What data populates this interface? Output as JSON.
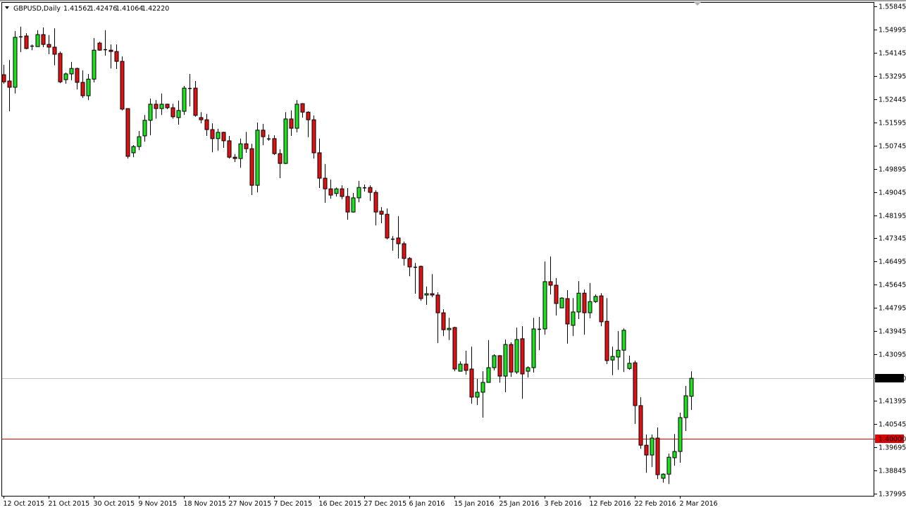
{
  "header": {
    "symbol": "GBPUSD,Daily",
    "open": "1.41562",
    "high": "1.42476",
    "low": "1.41064",
    "close": "1.42220"
  },
  "colors": {
    "bull": "#1ee01e",
    "bear": "#e01010",
    "wick": "#000000",
    "price_line": "#c0c0c0",
    "level_line": "#e00000"
  },
  "chart_data": {
    "type": "candlestick",
    "title": "GBPUSD,Daily",
    "xlabel": "",
    "ylabel": "",
    "ylim": [
      1.37995,
      1.55845
    ],
    "grid": false,
    "y_ticks": [
      "1.55845",
      "1.54995",
      "1.54145",
      "1.53295",
      "1.52445",
      "1.51595",
      "1.50745",
      "1.49895",
      "1.49045",
      "1.48195",
      "1.47345",
      "1.46495",
      "1.45645",
      "1.44795",
      "1.43945",
      "1.43095",
      "1.42220",
      "1.41395",
      "1.40545",
      "1.40000",
      "1.39695",
      "1.38845",
      "1.37995"
    ],
    "x_ticks": [
      {
        "bar": 0,
        "label": "12 Oct 2015"
      },
      {
        "bar": 8,
        "label": "21 Oct 2015"
      },
      {
        "bar": 16,
        "label": "30 Oct 2015"
      },
      {
        "bar": 24,
        "label": "9 Nov 2015"
      },
      {
        "bar": 32,
        "label": "18 Nov 2015"
      },
      {
        "bar": 40,
        "label": "27 Nov 2015"
      },
      {
        "bar": 48,
        "label": "7 Dec 2015"
      },
      {
        "bar": 56,
        "label": "16 Dec 2015"
      },
      {
        "bar": 64,
        "label": "27 Dec 2015"
      },
      {
        "bar": 72,
        "label": "6 Jan 2016"
      },
      {
        "bar": 80,
        "label": "15 Jan 2016"
      },
      {
        "bar": 88,
        "label": "25 Jan 2016"
      },
      {
        "bar": 96,
        "label": "3 Feb 2016"
      },
      {
        "bar": 104,
        "label": "12 Feb 2016"
      },
      {
        "bar": 112,
        "label": "22 Feb 2016"
      },
      {
        "bar": 120,
        "label": "2 Mar 2016"
      }
    ],
    "horizontal_lines": [
      {
        "value": 1.4222,
        "label": "1.42220",
        "kind": "current-price"
      },
      {
        "value": 1.4,
        "label": "1.40000",
        "kind": "level"
      }
    ],
    "ohlc_fields": [
      "open",
      "high",
      "low",
      "close"
    ],
    "ohlc": [
      [
        1.5334,
        1.537,
        1.5301,
        1.5308
      ],
      [
        1.5311,
        1.5388,
        1.52,
        1.5288
      ],
      [
        1.5288,
        1.5494,
        1.5265,
        1.5471
      ],
      [
        1.5471,
        1.551,
        1.5417,
        1.5474
      ],
      [
        1.5476,
        1.5486,
        1.5427,
        1.543
      ],
      [
        1.5437,
        1.5445,
        1.5424,
        1.544
      ],
      [
        1.5437,
        1.5497,
        1.5437,
        1.5481
      ],
      [
        1.5481,
        1.5507,
        1.5435,
        1.5445
      ],
      [
        1.5445,
        1.5479,
        1.5409,
        1.5435
      ],
      [
        1.5435,
        1.5504,
        1.5368,
        1.5409
      ],
      [
        1.5412,
        1.5419,
        1.5303,
        1.5308
      ],
      [
        1.5316,
        1.5342,
        1.5301,
        1.5337
      ],
      [
        1.5337,
        1.5381,
        1.5314,
        1.5357
      ],
      [
        1.5357,
        1.536,
        1.528,
        1.5306
      ],
      [
        1.5306,
        1.535,
        1.5249,
        1.5257
      ],
      [
        1.5257,
        1.5337,
        1.5241,
        1.5318
      ],
      [
        1.5318,
        1.5468,
        1.5306,
        1.5424
      ],
      [
        1.545,
        1.5455,
        1.5422,
        1.5424
      ],
      [
        1.5427,
        1.5497,
        1.5404,
        1.5424
      ],
      [
        1.5424,
        1.5445,
        1.5357,
        1.5419
      ],
      [
        1.5419,
        1.5445,
        1.5355,
        1.5383
      ],
      [
        1.5383,
        1.5401,
        1.5203,
        1.5208
      ],
      [
        1.521,
        1.521,
        1.5027,
        1.5035
      ],
      [
        1.5048,
        1.5076,
        1.5032,
        1.5071
      ],
      [
        1.5071,
        1.5128,
        1.5058,
        1.5107
      ],
      [
        1.511,
        1.5187,
        1.5089,
        1.5167
      ],
      [
        1.5167,
        1.5247,
        1.5112,
        1.5226
      ],
      [
        1.5226,
        1.5241,
        1.5173,
        1.521
      ],
      [
        1.521,
        1.5265,
        1.5187,
        1.5226
      ],
      [
        1.5226,
        1.5228,
        1.5208,
        1.5213
      ],
      [
        1.5213,
        1.5228,
        1.5173,
        1.518
      ],
      [
        1.5177,
        1.5239,
        1.5151,
        1.5203
      ],
      [
        1.52,
        1.5293,
        1.5187,
        1.5285
      ],
      [
        1.5285,
        1.5337,
        1.5218,
        1.5284
      ],
      [
        1.5285,
        1.5311,
        1.518,
        1.5185
      ],
      [
        1.5177,
        1.5197,
        1.5156,
        1.5169
      ],
      [
        1.5169,
        1.519,
        1.511,
        1.5133
      ],
      [
        1.5133,
        1.5156,
        1.505,
        1.51
      ],
      [
        1.51,
        1.5136,
        1.5056,
        1.5123
      ],
      [
        1.5123,
        1.5125,
        1.5066,
        1.5092
      ],
      [
        1.5092,
        1.511,
        1.5027,
        1.5032
      ],
      [
        1.5032,
        1.5043,
        1.5014,
        1.5027
      ],
      [
        1.5027,
        1.51,
        1.4993,
        1.5081
      ],
      [
        1.5081,
        1.5125,
        1.5048,
        1.5063
      ],
      [
        1.5063,
        1.5081,
        1.4893,
        1.4929
      ],
      [
        1.4929,
        1.5159,
        1.4903,
        1.5131
      ],
      [
        1.5131,
        1.5154,
        1.5076,
        1.5107
      ],
      [
        1.51,
        1.5115,
        1.5092,
        1.5099
      ],
      [
        1.51,
        1.5112,
        1.504,
        1.5045
      ],
      [
        1.5045,
        1.5061,
        1.4955,
        1.5009
      ],
      [
        1.5009,
        1.5197,
        1.5007,
        1.5172
      ],
      [
        1.5172,
        1.5203,
        1.511,
        1.5138
      ],
      [
        1.5138,
        1.5241,
        1.5123,
        1.5226
      ],
      [
        1.5228,
        1.523,
        1.5177,
        1.5197
      ],
      [
        1.5197,
        1.52,
        1.5105,
        1.5169
      ],
      [
        1.5169,
        1.5185,
        1.5027,
        1.5048
      ],
      [
        1.5048,
        1.51,
        1.4919,
        1.4955
      ],
      [
        1.4955,
        1.5007,
        1.4865,
        1.4916
      ],
      [
        1.4916,
        1.495,
        1.488,
        1.4893
      ],
      [
        1.4899,
        1.4921,
        1.4888,
        1.4916
      ],
      [
        1.4916,
        1.4929,
        1.4878,
        1.4888
      ],
      [
        1.4888,
        1.4919,
        1.4803,
        1.4831
      ],
      [
        1.4831,
        1.4901,
        1.4829,
        1.4883
      ],
      [
        1.4883,
        1.4945,
        1.4867,
        1.4921
      ],
      [
        1.4921,
        1.4932,
        1.4906,
        1.492
      ],
      [
        1.4921,
        1.4929,
        1.4872,
        1.4903
      ],
      [
        1.4903,
        1.4911,
        1.4782,
        1.4831
      ],
      [
        1.4834,
        1.4849,
        1.479,
        1.4823
      ],
      [
        1.4823,
        1.4844,
        1.4731,
        1.4736
      ],
      [
        1.4733,
        1.4743,
        1.4689,
        1.4732
      ],
      [
        1.4736,
        1.4816,
        1.4661,
        1.4715
      ],
      [
        1.4715,
        1.4723,
        1.4635,
        1.4661
      ],
      [
        1.4661,
        1.4666,
        1.4596,
        1.463
      ],
      [
        1.463,
        1.4645,
        1.4532,
        1.4629
      ],
      [
        1.4632,
        1.4635,
        1.4506,
        1.4514
      ],
      [
        1.4527,
        1.4558,
        1.4491,
        1.4532
      ],
      [
        1.4532,
        1.4604,
        1.4519,
        1.4527
      ],
      [
        1.4527,
        1.4537,
        1.4351,
        1.4462
      ],
      [
        1.4462,
        1.4475,
        1.4377,
        1.44
      ],
      [
        1.44,
        1.4444,
        1.4362,
        1.4405
      ],
      [
        1.4408,
        1.4411,
        1.4248,
        1.4256
      ],
      [
        1.4248,
        1.4284,
        1.4247,
        1.4274
      ],
      [
        1.4274,
        1.4323,
        1.4235,
        1.4251
      ],
      [
        1.4256,
        1.4338,
        1.4129,
        1.4153
      ],
      [
        1.4153,
        1.422,
        1.4124,
        1.4171
      ],
      [
        1.4171,
        1.4248,
        1.4078,
        1.4207
      ],
      [
        1.4207,
        1.4362,
        1.4206,
        1.4261
      ],
      [
        1.4261,
        1.431,
        1.4251,
        1.4305
      ],
      [
        1.4305,
        1.4307,
        1.4206,
        1.423
      ],
      [
        1.423,
        1.4364,
        1.4171,
        1.4346
      ],
      [
        1.4346,
        1.4354,
        1.4227,
        1.4245
      ],
      [
        1.4245,
        1.4408,
        1.4238,
        1.4364
      ],
      [
        1.4367,
        1.4413,
        1.4147,
        1.4238
      ],
      [
        1.4248,
        1.4266,
        1.4225,
        1.4261
      ],
      [
        1.4261,
        1.4444,
        1.4243,
        1.4403
      ],
      [
        1.4403,
        1.4447,
        1.4325,
        1.4402
      ],
      [
        1.4403,
        1.465,
        1.4382,
        1.4576
      ],
      [
        1.4576,
        1.4668,
        1.4529,
        1.4563
      ],
      [
        1.4563,
        1.4589,
        1.4452,
        1.4496
      ],
      [
        1.448,
        1.4519,
        1.4479,
        1.4516
      ],
      [
        1.4514,
        1.4545,
        1.4349,
        1.4421
      ],
      [
        1.4416,
        1.4516,
        1.4377,
        1.4465
      ],
      [
        1.4465,
        1.4578,
        1.4439,
        1.4534
      ],
      [
        1.4534,
        1.4547,
        1.4382,
        1.4462
      ],
      [
        1.4462,
        1.4571,
        1.4442,
        1.4503
      ],
      [
        1.4503,
        1.4529,
        1.4498,
        1.4522
      ],
      [
        1.4524,
        1.4534,
        1.4413,
        1.4429
      ],
      [
        1.4431,
        1.4516,
        1.4274,
        1.4287
      ],
      [
        1.4289,
        1.4338,
        1.4233,
        1.4302
      ],
      [
        1.43,
        1.4395,
        1.4253,
        1.4325
      ],
      [
        1.4325,
        1.4405,
        1.4245,
        1.4398
      ],
      [
        1.4258,
        1.4305,
        1.4253,
        1.4277
      ],
      [
        1.4279,
        1.4287,
        1.4055,
        1.4122
      ],
      [
        1.4122,
        1.4153,
        1.3964,
        1.3977
      ],
      [
        1.3977,
        1.4016,
        1.3876,
        1.3941
      ],
      [
        1.3941,
        1.4016,
        1.3897,
        1.4003
      ],
      [
        1.4003,
        1.4042,
        1.3853,
        1.3869
      ],
      [
        1.3856,
        1.3874,
        1.384,
        1.3871
      ],
      [
        1.3871,
        1.3946,
        1.3835,
        1.3933
      ],
      [
        1.3931,
        1.4018,
        1.3902,
        1.3954
      ],
      [
        1.3954,
        1.4096,
        1.3913,
        1.4078
      ],
      [
        1.4078,
        1.4194,
        1.4029,
        1.4158
      ],
      [
        1.41562,
        1.42476,
        1.41064,
        1.4222
      ]
    ]
  }
}
